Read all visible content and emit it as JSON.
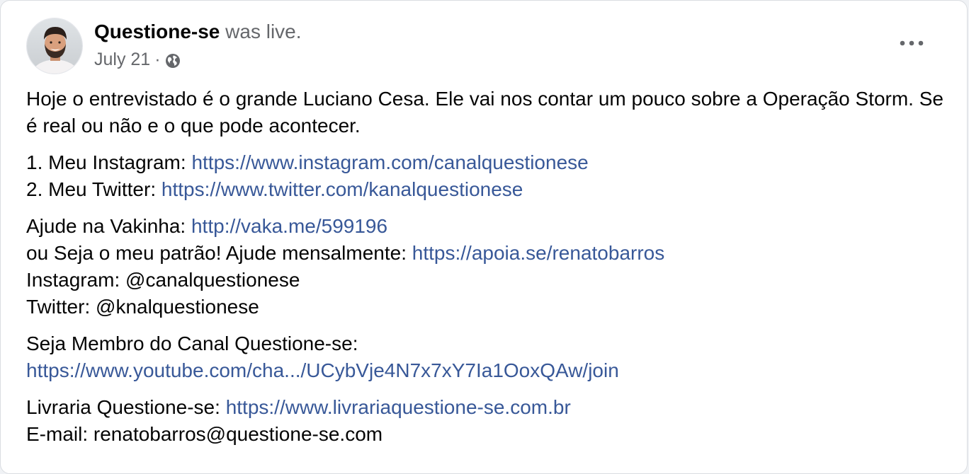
{
  "post": {
    "author": "Questione-se",
    "status": "was live.",
    "date": "July 21",
    "separator": "·",
    "privacy_icon": "globe-icon",
    "menu_icon": "more-horizontal-icon"
  },
  "body": {
    "intro": "Hoje o entrevistado é o grande Luciano Cesa. Ele vai nos contar um pouco sobre a Operação Storm. Se é real ou não e o que pode acontecer.",
    "instagram_label": "1. Meu Instagram: ",
    "instagram_link": "https://www.instagram.com/canalquestionese",
    "twitter_label": "2. Meu Twitter: ",
    "twitter_link": "https://www.twitter.com/kanalquestionese",
    "vakinha_label": "Ajude na Vakinha: ",
    "vakinha_link": "http://vaka.me/599196",
    "patrao_label": "ou Seja o meu patrão! Ajude mensalmente: ",
    "patrao_link": "https://apoia.se/renatobarros",
    "instagram_handle": "Instagram: @canalquestionese",
    "twitter_handle": "Twitter: @knalquestionese",
    "membro_label": "Seja Membro do Canal Questione-se:",
    "membro_link": "https://www.youtube.com/cha.../UCybVje4N7x7xY7Ia1OoxQAw/join",
    "livraria_label": "Livraria Questione-se: ",
    "livraria_link": "https://www.livrariaquestione-se.com.br",
    "email": "E-mail: renatobarros@questione-se.com"
  },
  "colors": {
    "link": "#385898",
    "text": "#050505",
    "secondary": "#65676b"
  }
}
